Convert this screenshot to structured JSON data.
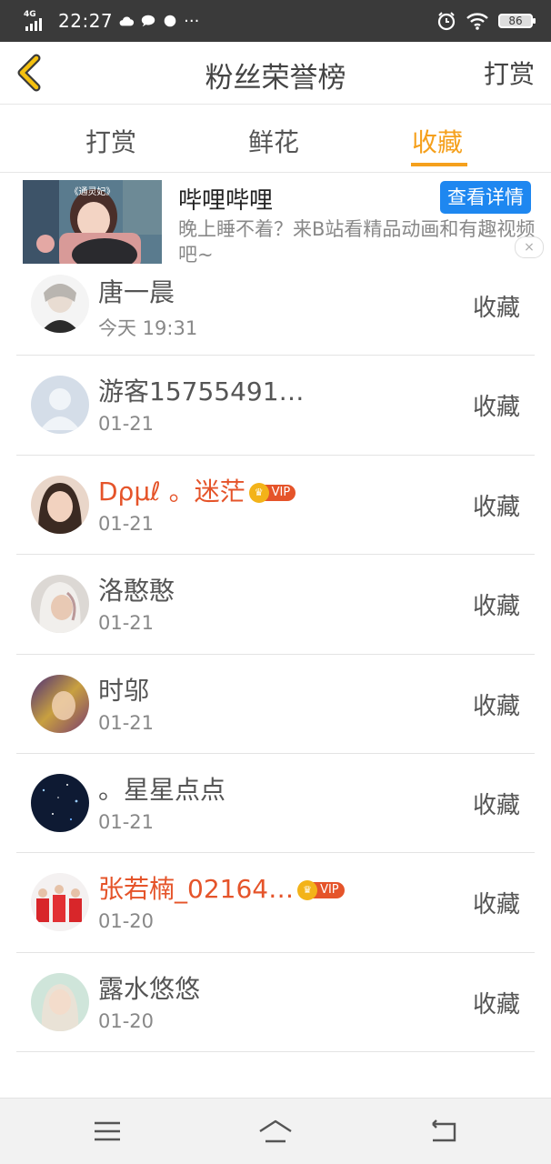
{
  "status_bar": {
    "network": "4G",
    "time": "22:27",
    "battery": "86"
  },
  "header": {
    "title": "粉丝荣誉榜",
    "right_action": "打赏"
  },
  "tabs": [
    {
      "label": "打赏",
      "active": false
    },
    {
      "label": "鲜花",
      "active": false
    },
    {
      "label": "收藏",
      "active": true
    }
  ],
  "ad": {
    "title": "哔哩哔哩",
    "description": "晚上睡不着？来B站看精品动画和有趣视频吧~",
    "button": "查看详情",
    "image_caption": "《通灵妃》",
    "close": "×"
  },
  "vip_label": "VIP",
  "rows": [
    {
      "name": "唐一晨",
      "date": "今天 19:31",
      "action": "收藏",
      "vip": false
    },
    {
      "name": "游客15755491…",
      "date": "01-21",
      "action": "收藏",
      "vip": false
    },
    {
      "name": "Dρμℓ 。迷茫",
      "date": "01-21",
      "action": "收藏",
      "vip": true
    },
    {
      "name": "洛憨憨",
      "date": "01-21",
      "action": "收藏",
      "vip": false
    },
    {
      "name": "时邬",
      "date": "01-21",
      "action": "收藏",
      "vip": false
    },
    {
      "name": "。星星点点",
      "date": "01-21",
      "action": "收藏",
      "vip": false
    },
    {
      "name": "张若楠_02164…",
      "date": "01-20",
      "action": "收藏",
      "vip": true
    },
    {
      "name": "露水悠悠",
      "date": "01-20",
      "action": "收藏",
      "vip": false
    }
  ],
  "colors": {
    "accent": "#f5a01c",
    "vip_name": "#e5542a",
    "ad_button": "#1e87f0",
    "status_bar": "#3a3a3a"
  },
  "icons": {
    "back": "back-chevron-icon",
    "nav_menu": "menu-icon",
    "nav_home": "home-icon",
    "nav_back": "return-icon"
  }
}
